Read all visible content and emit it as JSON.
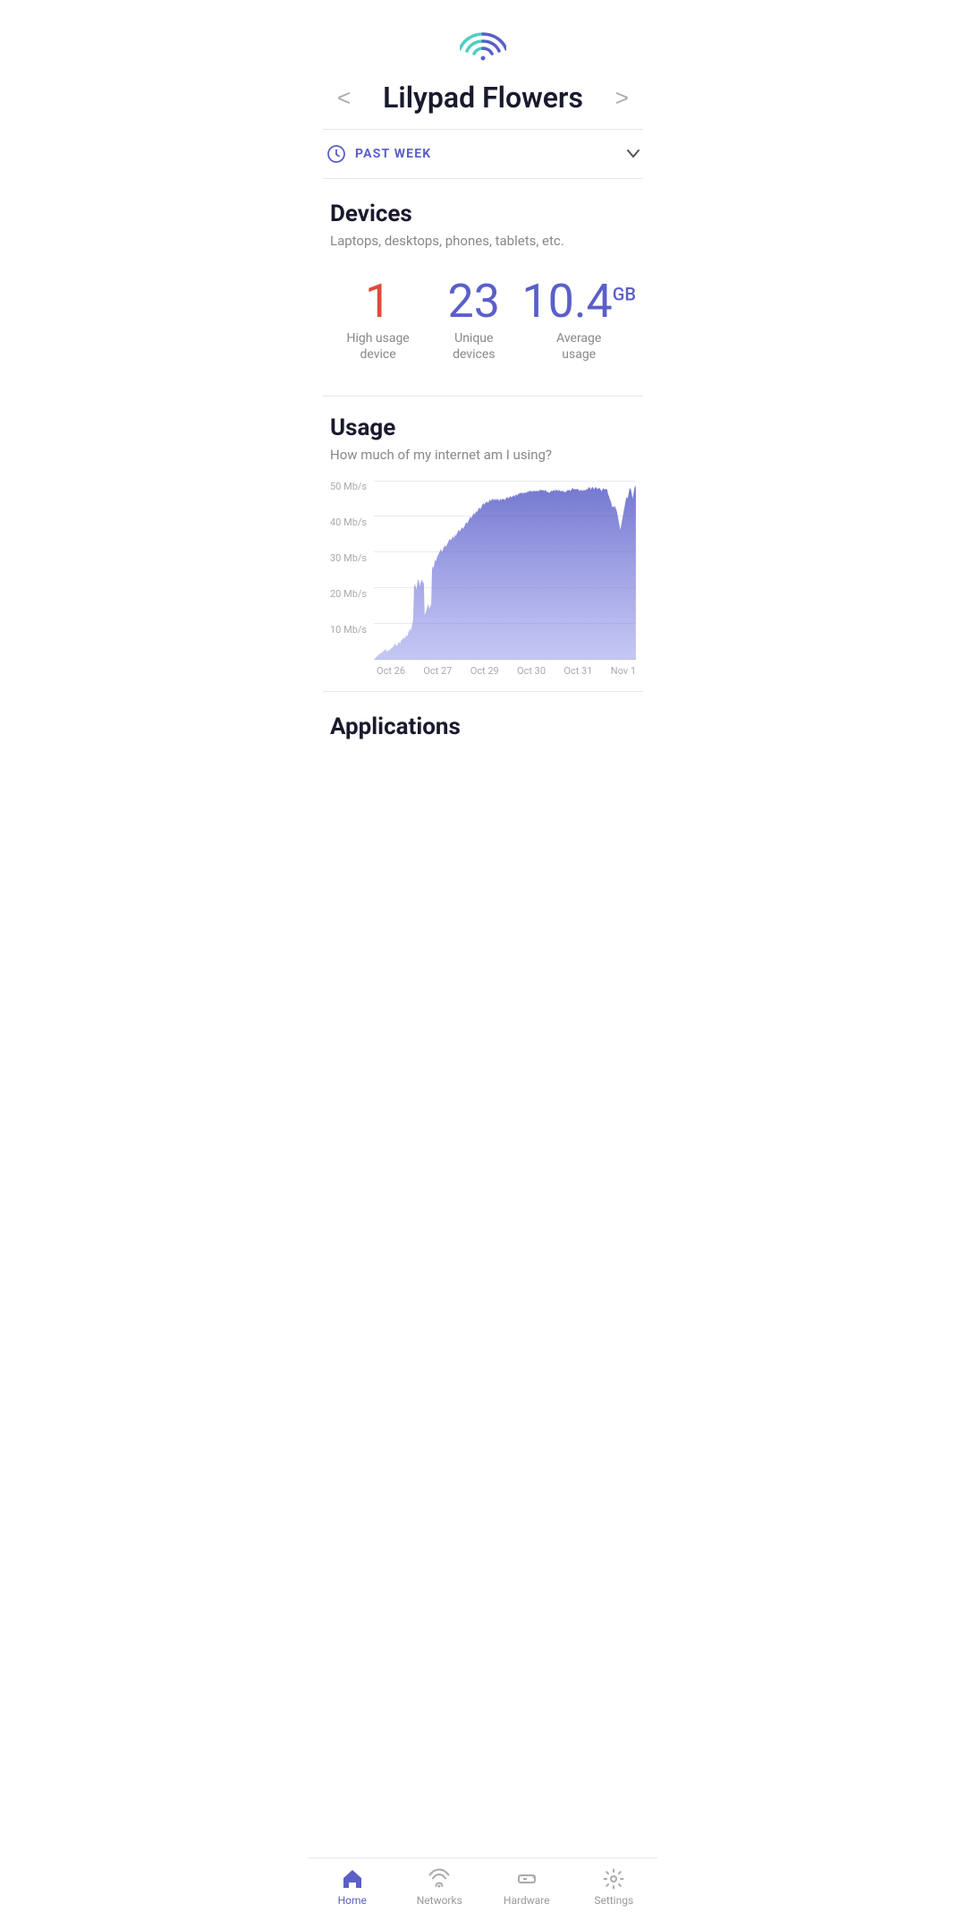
{
  "header": {
    "title": "Lilypad Flowers",
    "prev_label": "<",
    "next_label": ">"
  },
  "time_filter": {
    "label": "PAST WEEK",
    "clock_icon": "clock"
  },
  "devices": {
    "title": "Devices",
    "subtitle": "Laptops, desktops, phones, tablets, etc.",
    "stats": [
      {
        "value": "1",
        "color": "red",
        "label": "High usage\ndevice"
      },
      {
        "value": "23",
        "color": "blue",
        "label": "Unique\ndevices"
      },
      {
        "value": "10.4",
        "suffix": "GB",
        "color": "blue",
        "label": "Average\nusage"
      }
    ]
  },
  "usage": {
    "title": "Usage",
    "subtitle": "How much of my internet am I using?",
    "y_labels": [
      "50 Mb/s",
      "40 Mb/s",
      "30 Mb/s",
      "20 Mb/s",
      "10 Mb/s",
      ""
    ],
    "x_labels": [
      "Oct 26",
      "Oct 27",
      "Oct 29",
      "Oct 30",
      "Oct 31",
      "Nov 1"
    ]
  },
  "applications": {
    "title": "Applications"
  },
  "bottom_nav": [
    {
      "id": "home",
      "label": "Home",
      "active": true
    },
    {
      "id": "networks",
      "label": "Networks",
      "active": false
    },
    {
      "id": "hardware",
      "label": "Hardware",
      "active": false
    },
    {
      "id": "settings",
      "label": "Settings",
      "active": false
    }
  ]
}
